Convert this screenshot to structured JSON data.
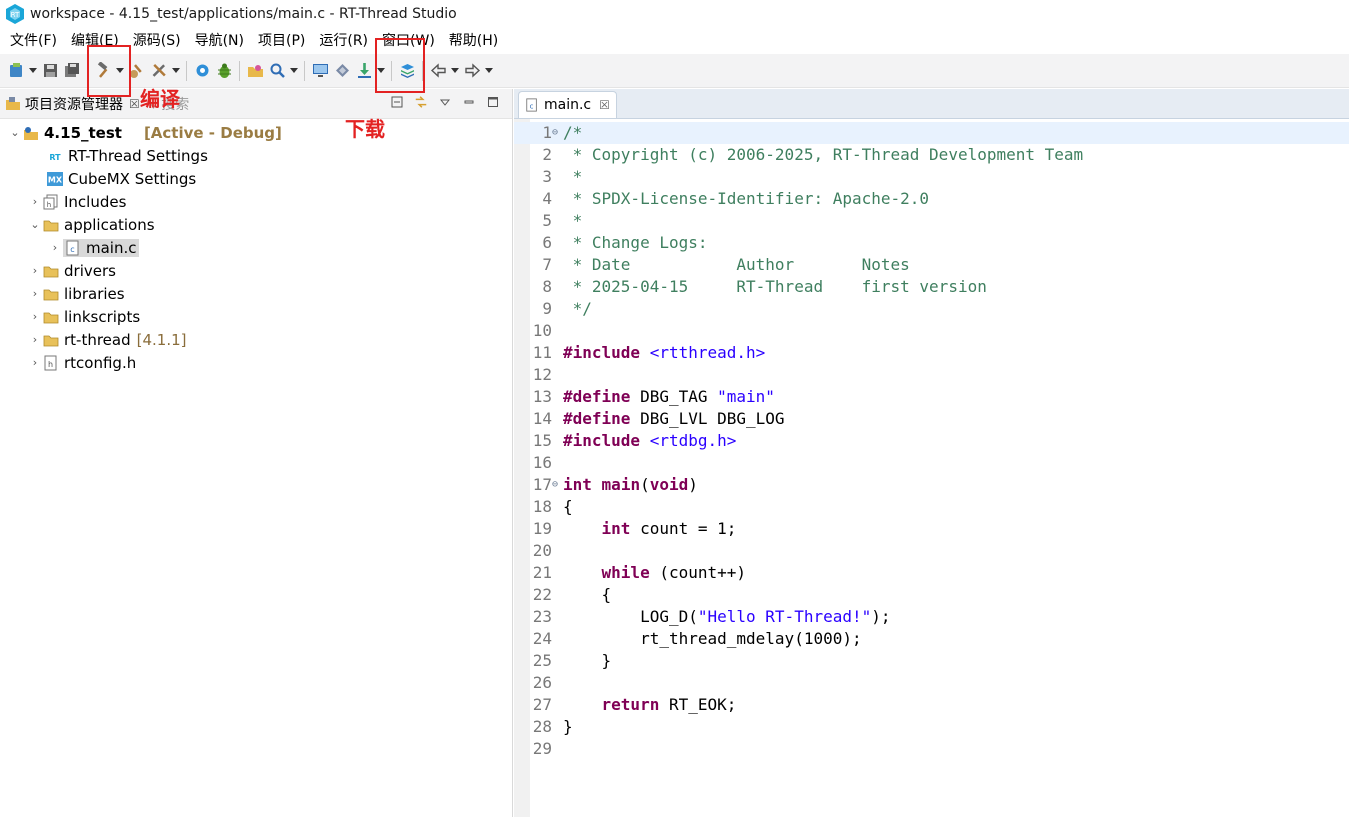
{
  "window": {
    "title": "workspace - 4.15_test/applications/main.c - RT-Thread Studio"
  },
  "menu": {
    "items": [
      "文件(F)",
      "编辑(E)",
      "源码(S)",
      "导航(N)",
      "项目(P)",
      "运行(R)",
      "窗口(W)",
      "帮助(H)"
    ]
  },
  "annotations": {
    "build_label": "编译",
    "download_label": "下载"
  },
  "explorer": {
    "title": "项目资源管理器",
    "close_symbol": "☒",
    "search_placeholder": "搜索",
    "project": {
      "name": "4.15_test",
      "decoration": "[Active - Debug]"
    },
    "items": [
      {
        "label": "RT-Thread Settings",
        "icon": "rt-settings-icon"
      },
      {
        "label": "CubeMX Settings",
        "icon": "cubemx-icon"
      },
      {
        "label": "Includes",
        "icon": "includes-icon"
      },
      {
        "label": "applications",
        "icon": "folder-icon"
      },
      {
        "label": "main.c",
        "icon": "c-file-icon"
      },
      {
        "label": "drivers",
        "icon": "folder-icon"
      },
      {
        "label": "libraries",
        "icon": "folder-icon"
      },
      {
        "label": "linkscripts",
        "icon": "folder-icon"
      },
      {
        "label": "rt-thread",
        "icon": "folder-icon",
        "decoration": "[4.1.1]"
      },
      {
        "label": "rtconfig.h",
        "icon": "h-file-icon"
      }
    ]
  },
  "editor": {
    "tab_label": "main.c",
    "tab_close": "☒",
    "lines": [
      {
        "n": "1",
        "segs": [
          [
            "c",
            "/*"
          ]
        ]
      },
      {
        "n": "2",
        "segs": [
          [
            "c",
            " * Copyright (c) 2006-2025, RT-Thread Development Team"
          ]
        ]
      },
      {
        "n": "3",
        "segs": [
          [
            "c",
            " *"
          ]
        ]
      },
      {
        "n": "4",
        "segs": [
          [
            "c",
            " * SPDX-License-Identifier: Apache-2.0"
          ]
        ]
      },
      {
        "n": "5",
        "segs": [
          [
            "c",
            " *"
          ]
        ]
      },
      {
        "n": "6",
        "segs": [
          [
            "c",
            " * Change Logs:"
          ]
        ]
      },
      {
        "n": "7",
        "segs": [
          [
            "c",
            " * Date           Author       Notes"
          ]
        ]
      },
      {
        "n": "8",
        "segs": [
          [
            "c",
            " * 2025-04-15     RT-Thread    first version"
          ]
        ]
      },
      {
        "n": "9",
        "segs": [
          [
            "c",
            " */"
          ]
        ]
      },
      {
        "n": "10",
        "segs": []
      },
      {
        "n": "11",
        "segs": [
          [
            "k",
            "#include"
          ],
          [
            "p",
            " "
          ],
          [
            "s",
            "<rtthread.h>"
          ]
        ]
      },
      {
        "n": "12",
        "segs": []
      },
      {
        "n": "13",
        "segs": [
          [
            "k",
            "#define"
          ],
          [
            "p",
            " DBG_TAG "
          ],
          [
            "s",
            "\"main\""
          ]
        ]
      },
      {
        "n": "14",
        "segs": [
          [
            "k",
            "#define"
          ],
          [
            "p",
            " DBG_LVL DBG_LOG"
          ]
        ]
      },
      {
        "n": "15",
        "segs": [
          [
            "k",
            "#include"
          ],
          [
            "p",
            " "
          ],
          [
            "s",
            "<rtdbg.h>"
          ]
        ]
      },
      {
        "n": "16",
        "segs": []
      },
      {
        "n": "17",
        "segs": [
          [
            "k",
            "int"
          ],
          [
            "p",
            " "
          ],
          [
            "k",
            "main"
          ],
          [
            "p",
            "("
          ],
          [
            "k",
            "void"
          ],
          [
            "p",
            ")"
          ]
        ]
      },
      {
        "n": "18",
        "segs": [
          [
            "p",
            "{"
          ]
        ]
      },
      {
        "n": "19",
        "segs": [
          [
            "p",
            "    "
          ],
          [
            "k",
            "int"
          ],
          [
            "p",
            " count = 1;"
          ]
        ]
      },
      {
        "n": "20",
        "segs": []
      },
      {
        "n": "21",
        "segs": [
          [
            "p",
            "    "
          ],
          [
            "k",
            "while"
          ],
          [
            "p",
            " (count++)"
          ]
        ]
      },
      {
        "n": "22",
        "segs": [
          [
            "p",
            "    {"
          ]
        ]
      },
      {
        "n": "23",
        "segs": [
          [
            "p",
            "        LOG_D("
          ],
          [
            "s",
            "\"Hello RT-Thread!\""
          ],
          [
            "p",
            ");"
          ]
        ]
      },
      {
        "n": "24",
        "segs": [
          [
            "p",
            "        rt_thread_mdelay(1000);"
          ]
        ]
      },
      {
        "n": "25",
        "segs": [
          [
            "p",
            "    }"
          ]
        ]
      },
      {
        "n": "26",
        "segs": []
      },
      {
        "n": "27",
        "segs": [
          [
            "p",
            "    "
          ],
          [
            "k",
            "return"
          ],
          [
            "p",
            " RT_EOK;"
          ]
        ]
      },
      {
        "n": "28",
        "segs": [
          [
            "p",
            "}"
          ]
        ]
      },
      {
        "n": "29",
        "segs": []
      }
    ]
  },
  "colors": {
    "annotation": "#e32222",
    "comment": "#3f7f5f",
    "keyword": "#7f0055",
    "string": "#2a00ff"
  }
}
